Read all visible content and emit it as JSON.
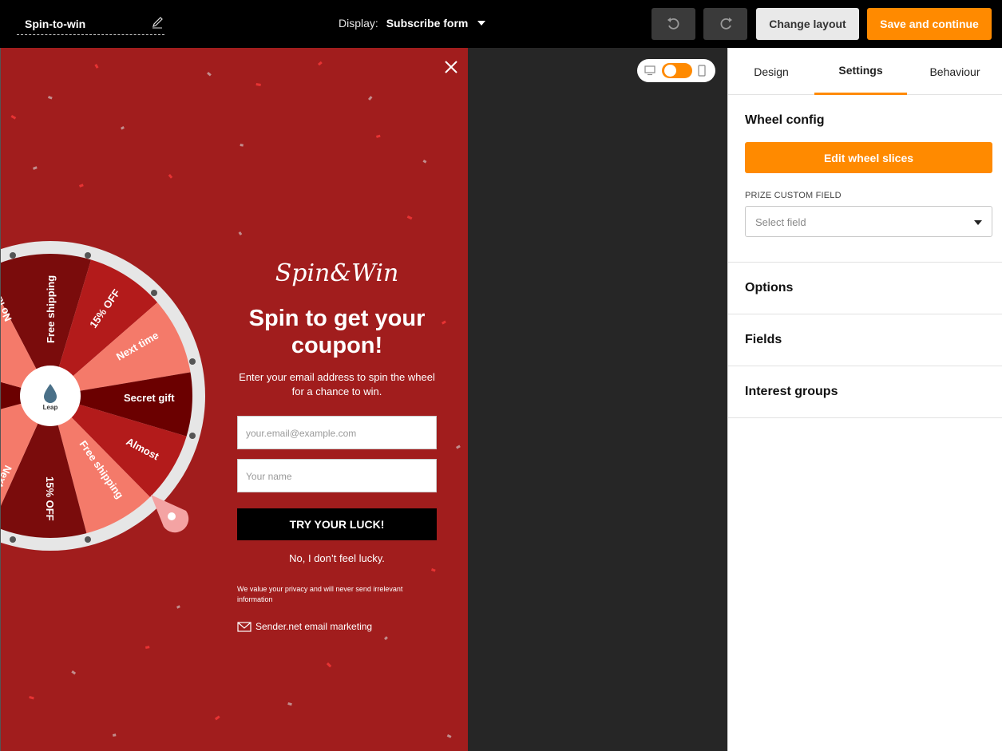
{
  "topbar": {
    "form_name": "Spin-to-win",
    "display_label": "Display:",
    "display_value": "Subscribe form",
    "change_layout": "Change layout",
    "save_continue": "Save and continue",
    "accent_color": "#ff8a00"
  },
  "popup": {
    "background_color": "#a11d1d",
    "brand": "Spin&Win",
    "headline": "Spin to get your coupon!",
    "subtext": "Enter your email address to spin the wheel for a chance to win.",
    "email_placeholder": "your.email@example.com",
    "name_placeholder": "Your name",
    "cta_label": "TRY YOUR LUCK!",
    "decline_label": "No, I don’t feel lucky.",
    "privacy_text": "We value your privacy and will never send irrelevant information",
    "sender_label": "Sender.net email marketing",
    "wheel": {
      "center_logo_text": "Leap",
      "visible_slices": [
        "No luck",
        "Free shipping",
        "15% OFF",
        "Next time",
        "Secret gift",
        "Almost",
        "Free shipping",
        "15% OFF",
        "Next"
      ]
    }
  },
  "panel": {
    "tabs": [
      "Design",
      "Settings",
      "Behaviour"
    ],
    "active_tab": "Settings",
    "wheel_config_title": "Wheel config",
    "edit_slices_label": "Edit wheel slices",
    "prize_field_label": "PRIZE CUSTOM FIELD",
    "prize_field_placeholder": "Select field",
    "sections": [
      "Options",
      "Fields",
      "Interest groups"
    ]
  }
}
